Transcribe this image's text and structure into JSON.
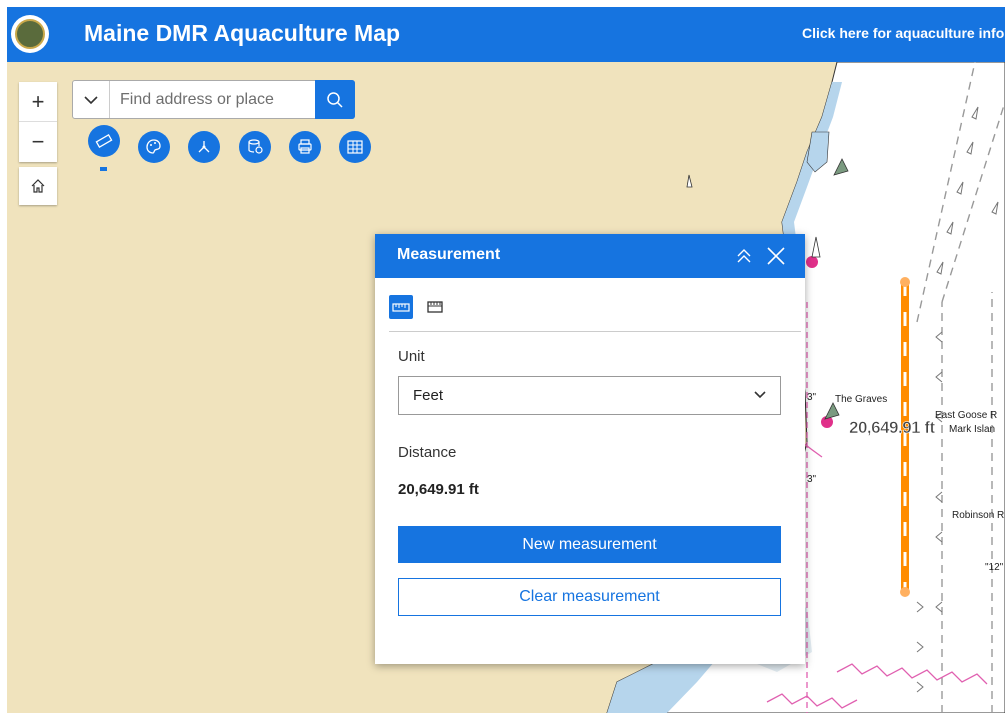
{
  "header": {
    "title": "Maine DMR Aquaculture Map",
    "link_text": "Click here for aquaculture infor"
  },
  "search": {
    "placeholder": "Find address or place"
  },
  "zoom": {
    "in_label": "+",
    "out_label": "−"
  },
  "tools": [
    {
      "icon": "ruler-icon"
    },
    {
      "icon": "palette-icon"
    },
    {
      "icon": "coordinate-icon"
    },
    {
      "icon": "layers-database-icon"
    },
    {
      "icon": "print-icon"
    },
    {
      "icon": "table-icon"
    }
  ],
  "panel": {
    "title": "Measurement",
    "unit_label": "Unit",
    "unit_value": "Feet",
    "distance_label": "Distance",
    "distance_value": "20,649.91 ft",
    "new_button": "New measurement",
    "clear_button": "Clear measurement"
  },
  "map": {
    "measure_label": "20,649.91 ft",
    "place_labels": {
      "the_graves": "The Graves",
      "east_goose": "East Goose R",
      "mark_island": "Mark Islan",
      "robinson": "Robinson R",
      "depth_12": "\"12\"",
      "depth_3a": "3\"",
      "depth_3b": "3\""
    }
  },
  "colors": {
    "accent": "#1674e0",
    "land": "#f0e3bd",
    "water": "#ffffff",
    "measure_line": "#ff8c00"
  }
}
